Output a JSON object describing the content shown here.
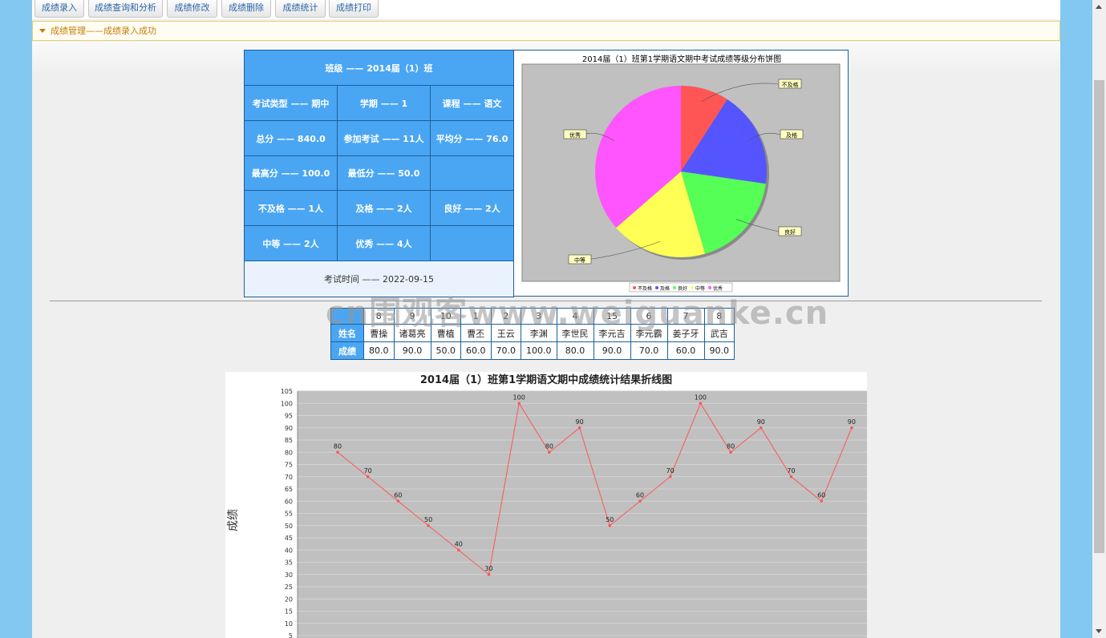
{
  "toolbar": {
    "buttons": [
      "成绩录入",
      "成绩查询和分析",
      "成绩修改",
      "成绩删除",
      "成绩统计",
      "成绩打印"
    ]
  },
  "notice": "成绩管理——成绩录入成功",
  "stats": {
    "class": "班级 —— 2014届（1）班",
    "exam_type": "考试类型 —— 期中",
    "term": "学期 —— 1",
    "course": "课程 —— 语文",
    "total": "总分 —— 840.0",
    "participants": "参加考试 —— 11人",
    "average": "平均分 —— 76.0",
    "max": "最高分 —— 100.0",
    "min": "最低分 —— 50.0",
    "fail": "不及格 —— 1人",
    "pass": "及格 —— 2人",
    "good": "良好 —— 2人",
    "medium": "中等 —— 2人",
    "excellent": "优秀 —— 4人",
    "exam_time": "考试时间 —— 2022-09-15"
  },
  "pie_chart": {
    "title": "2014届（1）班第1学期语文期中考试成绩等级分布饼图",
    "legend": [
      "不及格",
      "及格",
      "良好",
      "中等",
      "优秀"
    ],
    "slice_labels": [
      "不及格",
      "及格",
      "良好",
      "中等",
      "优秀"
    ],
    "colors": [
      "#ff5555",
      "#5555ff",
      "#55ff55",
      "#ffff55",
      "#ff55ff"
    ],
    "plot_bg": "#c0c0c0"
  },
  "scores_table": {
    "ids": [
      "8",
      "9",
      "10",
      "1",
      "2",
      "3",
      "4",
      "15",
      "6",
      "7",
      "8"
    ],
    "name_label": "姓名",
    "score_label": "成绩",
    "names": [
      "曹操",
      "诸葛亮",
      "曹植",
      "曹丕",
      "王云",
      "李渊",
      "李世民",
      "李元吉",
      "李元霸",
      "姜子牙",
      "武吉"
    ],
    "scores": [
      "80.0",
      "90.0",
      "50.0",
      "60.0",
      "70.0",
      "100.0",
      "80.0",
      "90.0",
      "70.0",
      "60.0",
      "90.0"
    ]
  },
  "watermark": "cn围观客www.weiguanke.cn",
  "chart_data": {
    "type": "line",
    "title": "2014届（1）班第1学期语文期中成绩统计结果折线图",
    "ylabel": "成绩",
    "xlabel": "",
    "ylim": [
      0,
      105
    ],
    "yticks": [
      5,
      10,
      15,
      20,
      25,
      30,
      35,
      40,
      45,
      50,
      55,
      60,
      65,
      70,
      75,
      80,
      85,
      90,
      95,
      100,
      105
    ],
    "series": [
      {
        "values": [
          80,
          70,
          60,
          50,
          40,
          30,
          100,
          80,
          90,
          50,
          60,
          70,
          100,
          80,
          90,
          70,
          60,
          90
        ],
        "color": "#ff5555"
      }
    ],
    "grid": true,
    "plot_bg": "#c0c0c0"
  }
}
